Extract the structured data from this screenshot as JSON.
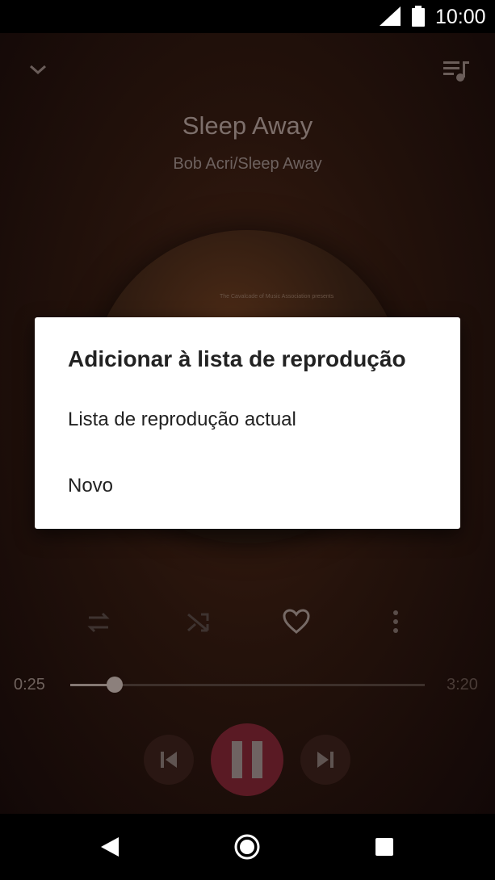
{
  "status_bar": {
    "time": "10:00"
  },
  "player": {
    "title": "Sleep Away",
    "artist": "Bob Acri/Sleep Away",
    "album_art_text": "The Cavalcade of Music Association presents",
    "current_time": "0:25",
    "total_time": "3:20",
    "progress_fraction": 0.125,
    "colors": {
      "accent": "#5a1a24",
      "background": "#24120b"
    }
  },
  "dialog": {
    "title": "Adicionar à lista de reprodução",
    "items": [
      {
        "label": "Lista de reprodução actual"
      },
      {
        "label": "Novo"
      }
    ]
  },
  "icons": {
    "collapse": "chevron-down-icon",
    "queue": "queue-music-icon",
    "repeat": "repeat-icon",
    "shuffle": "shuffle-icon",
    "favorite": "heart-icon",
    "more": "more-vert-icon",
    "previous": "skip-previous-icon",
    "pause": "pause-icon",
    "next": "skip-next-icon",
    "nav_back": "back-triangle-icon",
    "nav_home": "home-circle-icon",
    "nav_recents": "recents-square-icon"
  }
}
